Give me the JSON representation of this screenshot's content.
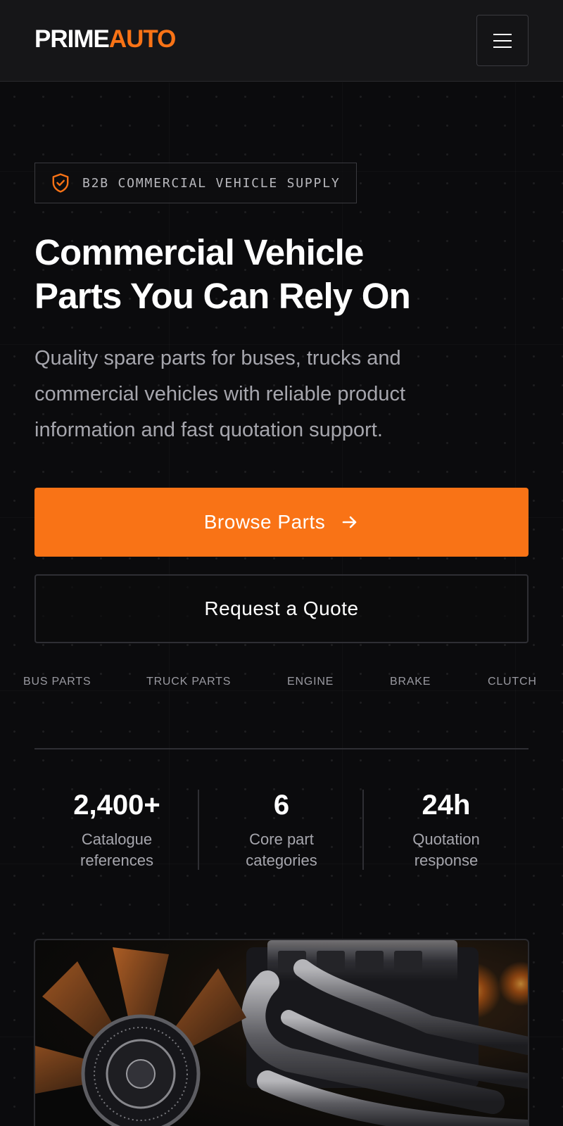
{
  "header": {
    "logo_part1": "PRIME",
    "logo_part2": "AUTO",
    "menu_icon": "hamburger-icon"
  },
  "hero": {
    "badge_icon": "shield-check-icon",
    "badge_text": "B2B COMMERCIAL VEHICLE SUPPLY",
    "title_line1": "Commercial Vehicle",
    "title_line2": "Parts You Can Rely On",
    "subtitle_line1": "Quality spare parts for buses, trucks and",
    "subtitle_line2": "commercial vehicles with reliable product",
    "subtitle_line3": "information and fast quotation support.",
    "primary_button": "Browse Parts",
    "primary_button_icon": "arrow-right-icon",
    "secondary_button": "Request a Quote"
  },
  "categories": [
    "BUS PARTS",
    "TRUCK PARTS",
    "ENGINE",
    "BRAKE",
    "CLUTCH"
  ],
  "stats": [
    {
      "value": "2,400+",
      "label_line1": "Catalogue",
      "label_line2": "references"
    },
    {
      "value": "6",
      "label_line1": "Core part",
      "label_line2": "categories"
    },
    {
      "value": "24h",
      "label_line1": "Quotation",
      "label_line2": "response"
    }
  ],
  "colors": {
    "accent": "#f97316",
    "background": "#0b0b0d",
    "header_bg": "#161618",
    "text_muted": "#a6a6ad"
  }
}
